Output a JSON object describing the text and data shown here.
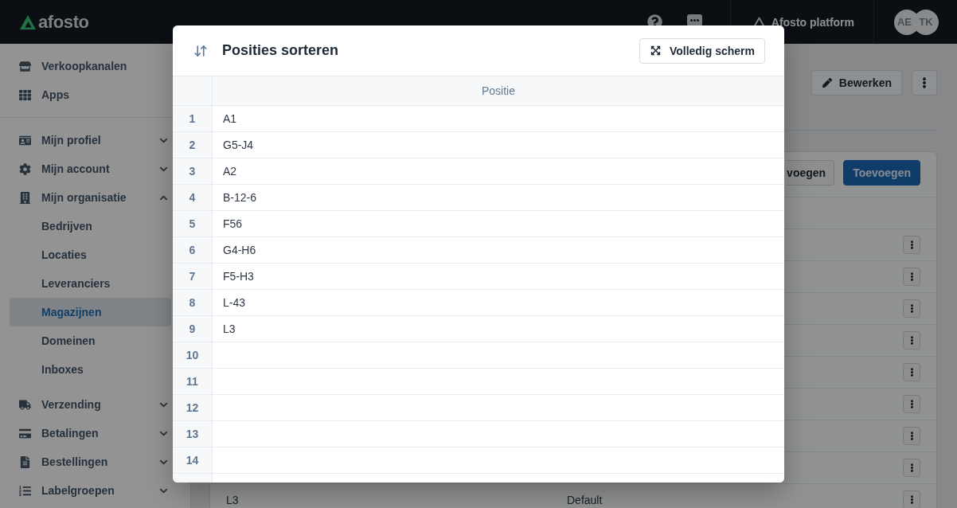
{
  "header": {
    "logo": "afosto",
    "workspace": "Afosto platform",
    "avatars": [
      {
        "initials": "AE"
      },
      {
        "initials": "TK"
      }
    ]
  },
  "sidebar": {
    "links": [
      {
        "label": "Verkoopkanalen",
        "selected": false
      },
      {
        "label": "Apps",
        "selected": false
      }
    ],
    "sections": [
      {
        "label": "Mijn profiel",
        "expanded": false
      },
      {
        "label": "Mijn account",
        "expanded": false
      },
      {
        "label": "Mijn organisatie",
        "expanded": true,
        "children": [
          {
            "label": "Bedrijven",
            "selected": false
          },
          {
            "label": "Locaties",
            "selected": false
          },
          {
            "label": "Leveranciers",
            "selected": false
          },
          {
            "label": "Magazijnen",
            "selected": true
          },
          {
            "label": "Domeinen",
            "selected": false
          },
          {
            "label": "Inboxes",
            "selected": false
          }
        ]
      },
      {
        "label": "Verzending",
        "expanded": false
      },
      {
        "label": "Betalingen",
        "expanded": false
      },
      {
        "label": "Bestellingen",
        "expanded": false
      },
      {
        "label": "Labelgroepen",
        "expanded": false
      }
    ]
  },
  "page": {
    "actions": [
      {
        "kind": "edit",
        "label": "Bewerken"
      },
      {
        "kind": "more"
      }
    ],
    "card": {
      "buttons": [
        {
          "kind": "secondary",
          "label": "voegen"
        },
        {
          "kind": "primary",
          "label": "Toevoegen"
        }
      ],
      "rows": [
        {
          "kind": "covered"
        },
        {
          "kind": "covered"
        },
        {
          "kind": "covered"
        },
        {
          "kind": "covered"
        },
        {
          "kind": "covered"
        },
        {
          "kind": "covered"
        },
        {
          "kind": "covered"
        },
        {
          "kind": "covered"
        },
        {
          "kind": "data",
          "cells": [
            "L3",
            "Default"
          ]
        }
      ]
    }
  },
  "dialog": {
    "title": "Posities sorteren",
    "fullscreen_button": "Volledig scherm",
    "table": {
      "columns": [
        "Positie"
      ],
      "rows": [
        {
          "number": "1",
          "position": "A1"
        },
        {
          "number": "2",
          "position": "G5-J4"
        },
        {
          "number": "3",
          "position": "A2"
        },
        {
          "number": "4",
          "position": "B-12-6"
        },
        {
          "number": "5",
          "position": "F56"
        },
        {
          "number": "6",
          "position": "G4-H6"
        },
        {
          "number": "7",
          "position": "F5-H3"
        },
        {
          "number": "8",
          "position": "L-43"
        },
        {
          "number": "9",
          "position": "L3"
        },
        {
          "number": "10"
        },
        {
          "number": "11"
        },
        {
          "number": "12"
        },
        {
          "number": "13"
        },
        {
          "number": "14"
        }
      ]
    }
  }
}
